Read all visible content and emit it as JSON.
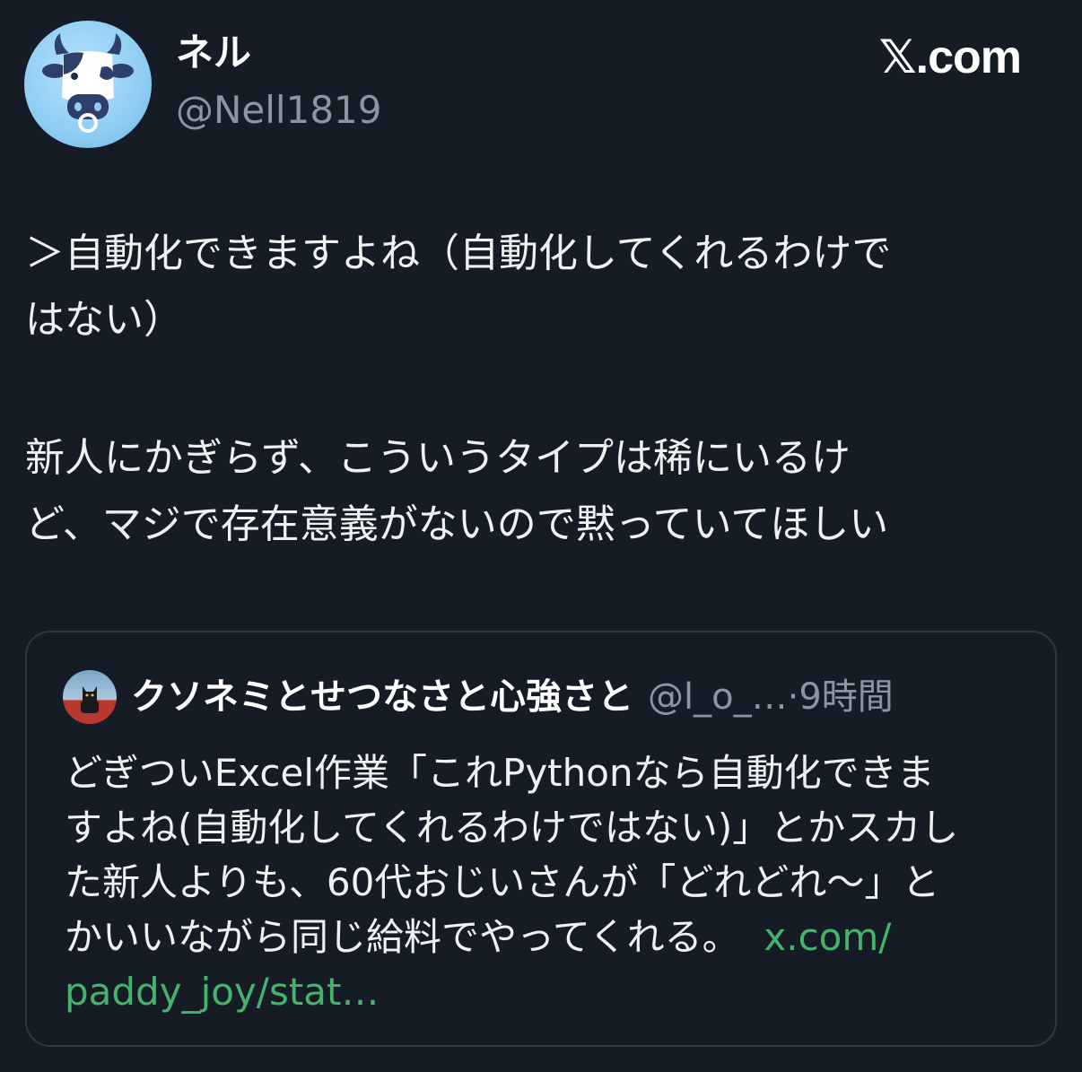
{
  "author": {
    "display_name": "ネル",
    "handle": "@Nell1819",
    "avatar_icon": "cow-face-icon"
  },
  "brand": "𝕏.com",
  "tweet": {
    "paragraph1": "＞自動化できますよね（自動化してくれるわけで\nはない）",
    "paragraph2": "新人にかぎらず、こういうタイプは稀にいるけ\nど、マジで存在意義がないので黙っていてほしい"
  },
  "quoted": {
    "display_name": "クソネミとせつなさと心強さと",
    "handle": "@l_o_…",
    "separator": "·",
    "time": "9時間",
    "avatar_icon": "cat-avatar-icon",
    "lines": [
      "どぎついExcel作業「これPythonなら自動化できま",
      "すよね(自動化してくれるわけではない)」とかスカし",
      "た新人よりも、60代おじいさんが「どれどれ〜」と",
      "かいいながら同じ給料でやってくれる。"
    ],
    "link_part1": "x.com/",
    "link_part2": "paddy_joy/stat…",
    "link_color": "#45b36b"
  }
}
